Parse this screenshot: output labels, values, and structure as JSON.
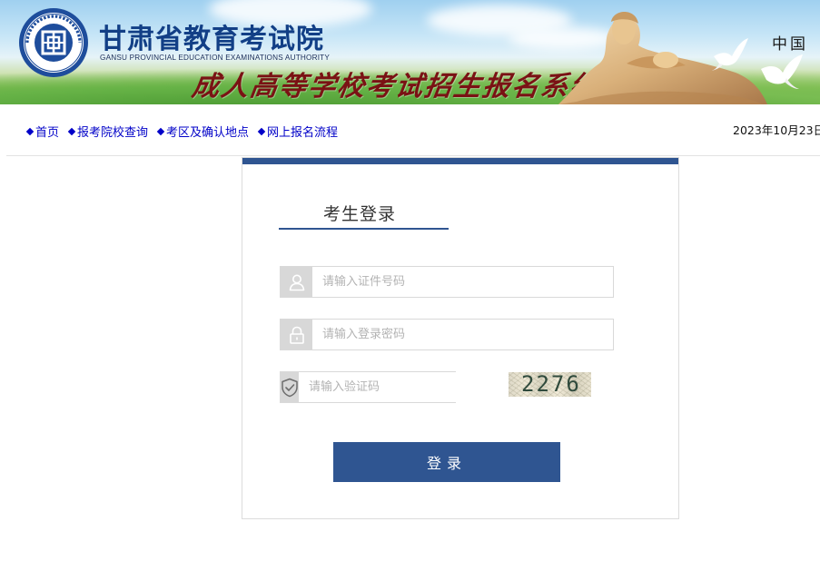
{
  "header": {
    "org_name_cn": "甘肃省教育考试院",
    "org_name_en": "GANSU PROVINCIAL EDUCATION EXAMINATIONS AUTHORITY",
    "system_title": "成人高等学校考试招生报名系统",
    "logo_text": "甘肃省教育考试院",
    "country": "中国"
  },
  "nav": {
    "items": [
      {
        "label": "首页"
      },
      {
        "label": "报考院校查询"
      },
      {
        "label": "考区及确认地点"
      },
      {
        "label": "网上报名流程"
      }
    ],
    "date": "2023年10月23日"
  },
  "login": {
    "title": "考生登录",
    "id_placeholder": "请输入证件号码",
    "password_placeholder": "请输入登录密码",
    "captcha_placeholder": "请输入验证码",
    "captcha_code": "2276",
    "submit_label": "登录"
  },
  "colors": {
    "accent": "#2f5591",
    "nav_link": "#0000c8",
    "title_blue": "#123f86",
    "subtitle_red": "#7a1214"
  },
  "icons": {
    "user": "user-icon",
    "lock": "lock-icon",
    "shield": "shield-check-icon"
  }
}
